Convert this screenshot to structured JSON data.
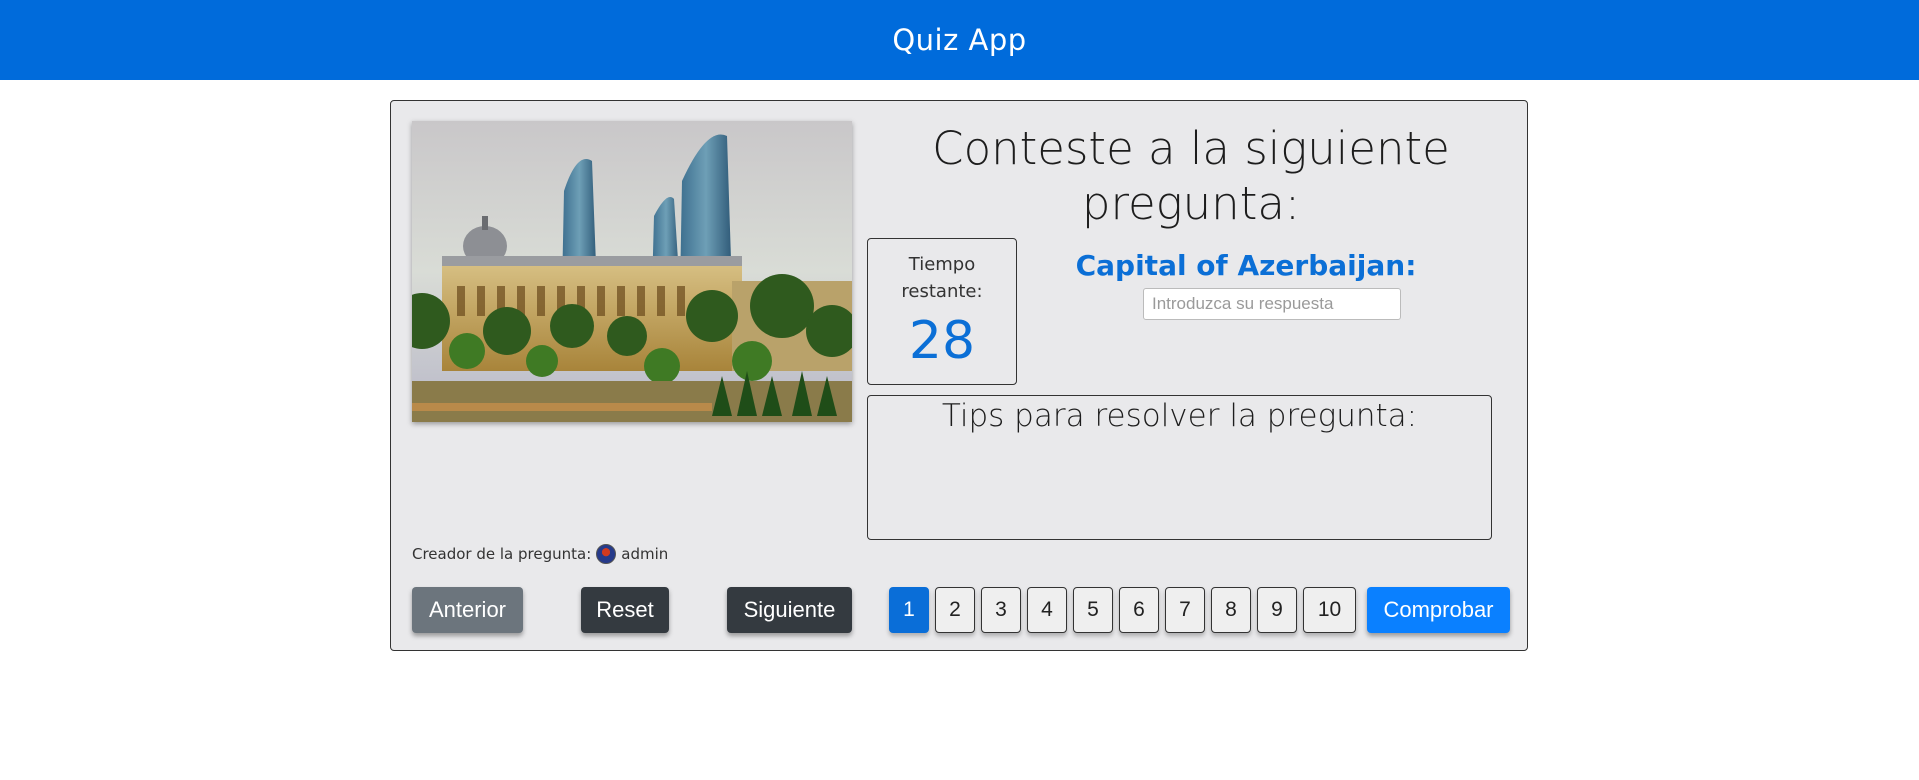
{
  "header": {
    "title": "Quiz App"
  },
  "question": {
    "heading": "Conteste a la siguiente pregunta:",
    "text": "Capital of Azerbaijan:",
    "answer_placeholder": "Introduzca su respuesta",
    "answer_value": ""
  },
  "timer": {
    "label": "Tiempo restante:",
    "value": "28"
  },
  "tips": {
    "title": "Tips para resolver la pregunta:"
  },
  "creator": {
    "label": "Creador de la pregunta:",
    "name": "admin"
  },
  "buttons": {
    "prev": "Anterior",
    "reset": "Reset",
    "next": "Siguiente",
    "check": "Comprobar"
  },
  "pagination": {
    "pages": [
      "1",
      "2",
      "3",
      "4",
      "5",
      "6",
      "7",
      "8",
      "9",
      "10"
    ],
    "active_index": 0
  },
  "colors": {
    "navbar": "#006bdb",
    "accent": "#0b6fd6",
    "check_button": "#0a80ff",
    "dark_button": "#343a40",
    "secondary_button": "#6c757d"
  }
}
